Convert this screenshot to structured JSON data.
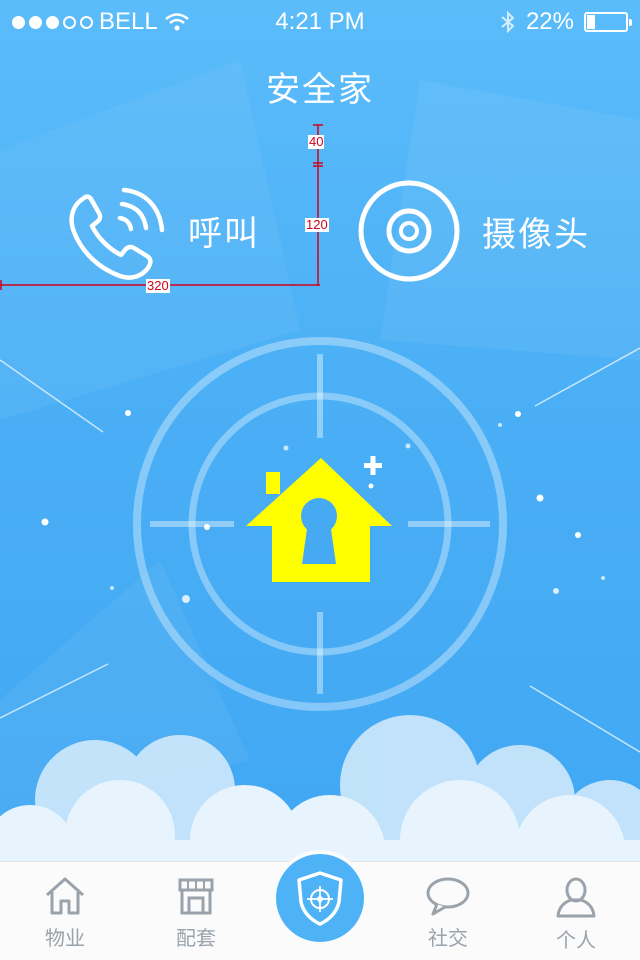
{
  "status_bar": {
    "carrier": "BELL",
    "signal_dots": [
      true,
      true,
      true,
      false,
      false
    ],
    "time": "4:21 PM",
    "battery_percent": "22%",
    "battery_level": 0.22
  },
  "header": {
    "title": "安全家"
  },
  "actions": {
    "call_label": "呼叫",
    "camera_label": "摄像头"
  },
  "annotations": {
    "top_gap": "40",
    "height": "120",
    "width": "320"
  },
  "tabs": [
    {
      "label": "物业",
      "icon": "home-icon"
    },
    {
      "label": "配套",
      "icon": "store-icon"
    },
    {
      "label": "",
      "icon": "shield-icon"
    },
    {
      "label": "社交",
      "icon": "chat-bubble-icon"
    },
    {
      "label": "个人",
      "icon": "person-icon"
    }
  ],
  "colors": {
    "background": "#49aef5",
    "lock_icon": "#ffff00",
    "tab_active": "#4db3f6",
    "tab_inactive": "#9aa3ab",
    "measure_line": "#d0021b"
  }
}
